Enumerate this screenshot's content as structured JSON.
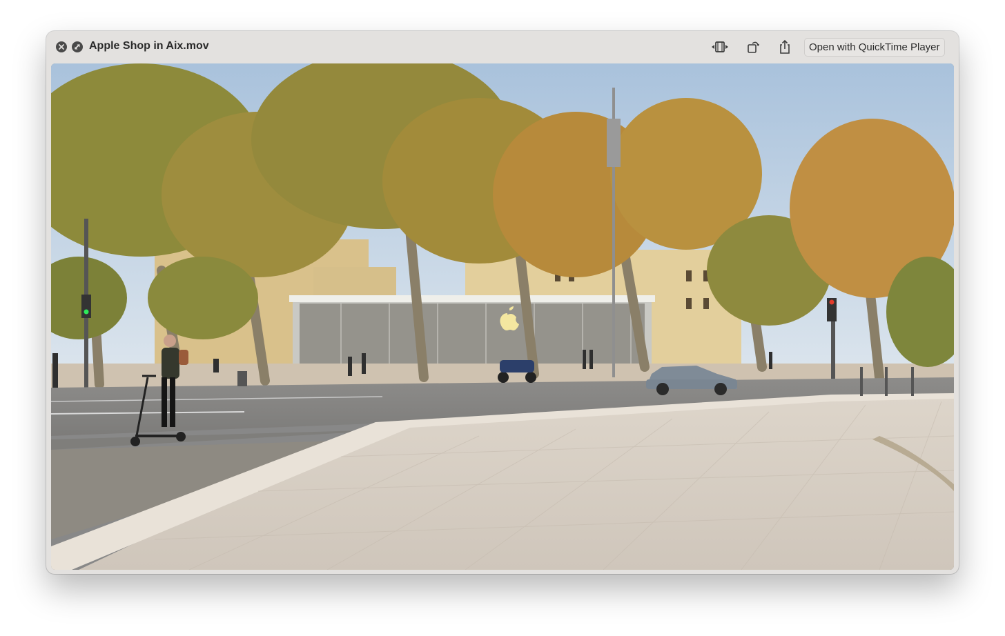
{
  "window": {
    "title": "Apple Shop in Aix.mov",
    "close_icon": "close-icon",
    "fullscreen_icon": "fullscreen-icon"
  },
  "toolbar": {
    "trim_icon": "trim-icon",
    "rotate_icon": "rotate-icon",
    "share_icon": "share-icon",
    "open_with_label": "Open with QuickTime Player"
  },
  "video": {
    "description_icon": "video-frame"
  },
  "colors": {
    "titlebar": "#e3e1df",
    "icon": "#3b3b3b",
    "sky": "#b8cde0",
    "foliage": "#9a8b3a",
    "pavement": "#d8cfc4"
  }
}
